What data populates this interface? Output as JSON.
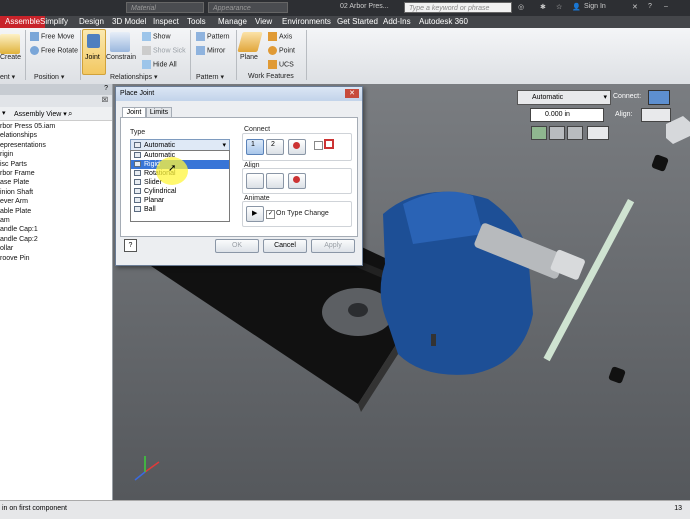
{
  "titlebar": {
    "material": "Material",
    "appearance": "Appearance",
    "doc_title": "02 Arbor Pres...",
    "search_placeholder": "Type a keyword or phrase",
    "sign_in": "Sign In"
  },
  "menu": [
    "Assemble",
    "Simplify",
    "Design",
    "3D Model",
    "Inspect",
    "Tools",
    "Manage",
    "View",
    "Environments",
    "Get Started",
    "Add-Ins",
    "Autodesk 360"
  ],
  "ribbon": {
    "create": "Create",
    "free_move": "Free Move",
    "free_rotate": "Free Rotate",
    "joint": "Joint",
    "constrain": "Constrain",
    "show": "Show",
    "show_sick": "Show Sick",
    "hide_all": "Hide All",
    "pattern": "Pattern",
    "mirror": "Mirror",
    "plane": "Plane",
    "axis": "Axis",
    "point": "Point",
    "ucs": "UCS",
    "panels": [
      "ent ▾",
      "Position ▾",
      "Relationships ▾",
      "Pattern ▾",
      "Work Features"
    ]
  },
  "browser": {
    "view": "Assembly View",
    "items": [
      "rbor Press 05.iam",
      "elationships",
      "epresentations",
      "rigin",
      "isc Parts",
      "rbor Frame",
      "ase Plate",
      "inion Shaft",
      "ever Arm",
      "able Plate",
      "am",
      "andle Cap:1",
      "andle Cap:2",
      "ollar",
      "roove Pin"
    ]
  },
  "dialog": {
    "title": "Place Joint",
    "tabs": [
      "Joint",
      "Limits"
    ],
    "type_label": "Type",
    "type_value": "Automatic",
    "options": [
      "Automatic",
      "Rigid",
      "Rotational",
      "Slider",
      "Cylindrical",
      "Planar",
      "Ball"
    ],
    "selected_option": "Rigid",
    "connect_label": "Connect",
    "align_label": "Align",
    "animate_label": "Animate",
    "on_type_change": "On Type Change",
    "ok": "OK",
    "cancel": "Cancel",
    "apply": "Apply"
  },
  "minitoolbar": {
    "mode": "Automatic",
    "connect": "Connect:",
    "offset": "0.000 in",
    "align": "Align:"
  },
  "status": {
    "message": "in on first component",
    "count": "13"
  }
}
